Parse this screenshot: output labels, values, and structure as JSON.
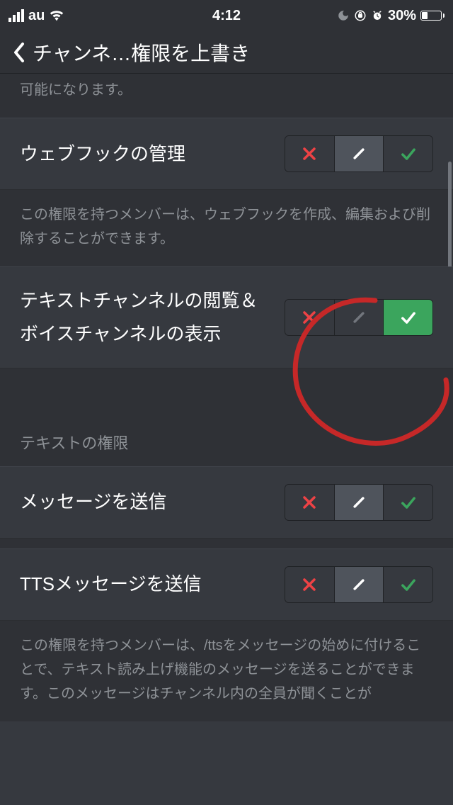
{
  "status": {
    "carrier": "au",
    "time": "4:12",
    "battery_pct": "30%"
  },
  "nav": {
    "title": "チャンネ…権限を上書き"
  },
  "partial_desc_top": "可能になります。",
  "permissions": [
    {
      "label": "ウェブフックの管理",
      "state": "neutral",
      "desc": "この権限を持つメンバーは、ウェブフックを作成、編集および削除することができます。"
    },
    {
      "label": "テキストチャンネルの閲覧＆ボイスチャンネルの表示",
      "state": "allow",
      "desc": ""
    }
  ],
  "section_header": "テキストの権限",
  "text_permissions": [
    {
      "label": "メッセージを送信",
      "state": "neutral"
    },
    {
      "label": "TTSメッセージを送信",
      "state": "neutral"
    }
  ],
  "tts_desc": "この権限を持つメンバーは、/ttsをメッセージの始めに付けることで、テキスト読み上げ機能のメッセージを送ることができます。このメッセージはチャンネル内の全員が聞くことが"
}
